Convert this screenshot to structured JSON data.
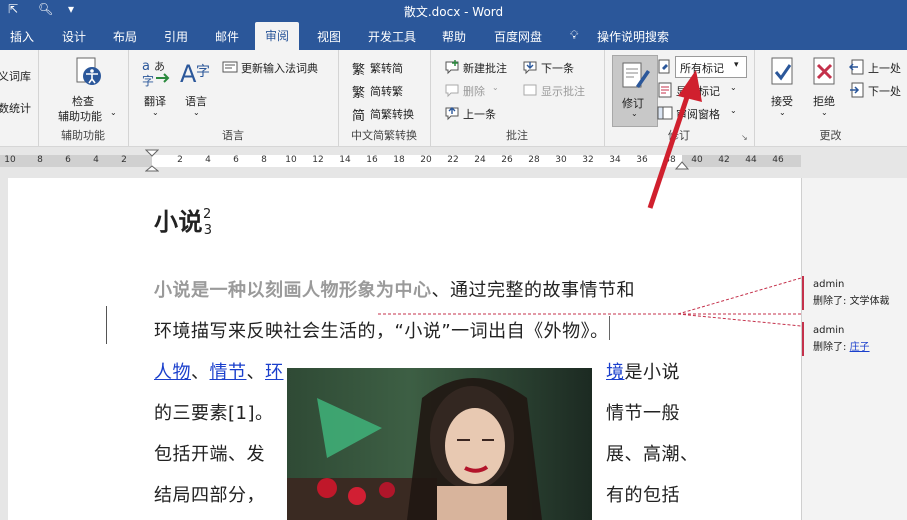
{
  "window": {
    "title": "散文.docx  -  Word"
  },
  "tabs": [
    "插入",
    "设计",
    "布局",
    "引用",
    "邮件",
    "审阅",
    "视图",
    "开发工具",
    "帮助",
    "百度网盘",
    "操作说明搜索"
  ],
  "active_tab": "审阅",
  "ribbon": {
    "partial_left": {
      "item1": "义词库",
      "item2": "数统计"
    },
    "accessibility": {
      "button": "检查",
      "button2": "辅助功能",
      "group": "辅助功能"
    },
    "language": {
      "translate": "翻译",
      "language": "语言",
      "update_ime": "更新输入法词典",
      "group": "语言"
    },
    "chinese_conv": {
      "to_simplified": "繁转简",
      "to_traditional": "简转繁",
      "conversion": "简繁转换",
      "group": "中文简繁转换"
    },
    "comments": {
      "new": "新建批注",
      "delete": "删除",
      "previous": "上一条",
      "next": "下一条",
      "show": "显示批注",
      "group": "批注"
    },
    "tracking": {
      "track": "修订",
      "markup_select": "所有标记",
      "show_markup": "显示标记",
      "review_pane": "审阅窗格",
      "group": "修订"
    },
    "changes": {
      "accept": "接受",
      "reject": "拒绝",
      "previous": "上一处",
      "next": "下一处",
      "group": "更改"
    }
  },
  "ruler": {
    "left_numbers": [
      "10",
      "8",
      "6",
      "4",
      "2"
    ],
    "right_numbers": [
      "2",
      "4",
      "6",
      "8",
      "10",
      "12",
      "14",
      "16",
      "18",
      "20",
      "22",
      "24",
      "26",
      "28",
      "30",
      "32",
      "34",
      "36",
      "38",
      "40",
      "42",
      "44",
      "46"
    ]
  },
  "document": {
    "title": "小说",
    "title_sup": "2",
    "title_sub": "3",
    "p1_line1_bold": "小说是一种以刻画人物形象为中心",
    "p1_line1_rest": "、通过完整的故事情节和",
    "p1_line2": "环境描写来反映社会生活的，“小说”一词出自《外物》。",
    "links": [
      "人物",
      "情节",
      "环"
    ],
    "link_sep": "、",
    "right_link": "境",
    "right_line1": "是小说",
    "left_line2": "的三要素[1]。",
    "right_line2": "情节一般",
    "left_line3": "包括开端、发",
    "right_line3": "展、高潮、",
    "left_line4": "结局四部分，",
    "right_line4": "有的包括"
  },
  "comments": [
    {
      "author": "admin",
      "label": "删除了:",
      "text": "文学体裁"
    },
    {
      "author": "admin",
      "label": "删除了:",
      "text": "庄子"
    }
  ],
  "colors": {
    "brand": "#2b579a",
    "revision": "#c4314b",
    "link": "#1a3fcc",
    "arrow": "#d0202e"
  }
}
